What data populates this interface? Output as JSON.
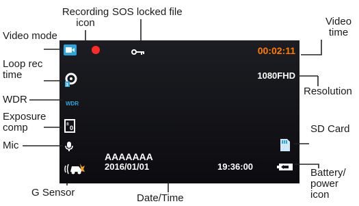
{
  "labels": {
    "recording_icon": [
      "Recording",
      "icon"
    ],
    "sos_locked_file": "SOS locked file",
    "video_time": [
      "Video",
      "time"
    ],
    "video_mode": "Video mode",
    "loop_rec_time": [
      "Loop rec",
      "time"
    ],
    "resolution": "Resolution",
    "wdr": "WDR",
    "exposure_comp": [
      "Exposure",
      "comp"
    ],
    "sd_card": "SD Card",
    "mic": "Mic",
    "battery_power_icon": [
      "Battery/",
      "power",
      "icon"
    ],
    "g_sensor": "G Sensor",
    "date_time": "Date/Time"
  },
  "screen": {
    "video_time": "00:02:11",
    "resolution": "1080FHD",
    "wdr_badge": "WDR",
    "plate": "AAAAAAA",
    "date": "2016/01/01",
    "time": "19:36:00"
  },
  "colors": {
    "accent_blue": "#2aa7e1",
    "record_red": "#ff2a2a",
    "time_orange": "#ff7a00",
    "screen_bg": "#141419",
    "gsensor_orange": "#f5a020"
  },
  "icons": [
    "video-mode-icon",
    "record-dot-icon",
    "key-lock-icon",
    "loop-rec-icon",
    "wdr-icon",
    "exposure-icon",
    "mic-icon",
    "g-sensor-icon",
    "sd-card-icon",
    "battery-icon"
  ]
}
